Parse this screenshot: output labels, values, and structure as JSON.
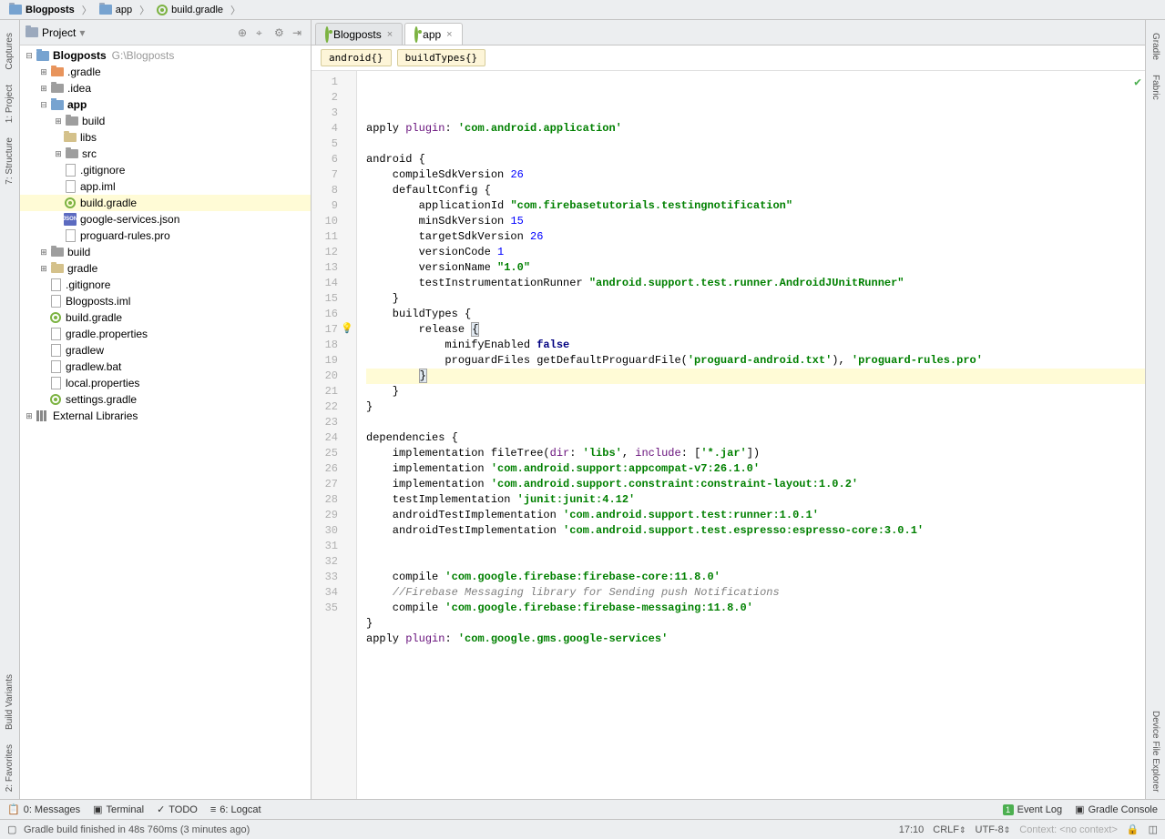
{
  "breadcrumbs": [
    "Blogposts",
    "app",
    "build.gradle"
  ],
  "project_panel": {
    "title": "Project",
    "root_name": "Blogposts",
    "root_path": "G:\\Blogposts",
    "nodes": {
      "gradle_dir": ".gradle",
      "idea_dir": ".idea",
      "app": "app",
      "app_build": "build",
      "app_libs": "libs",
      "app_src": "src",
      "gitignore": ".gitignore",
      "app_iml": "app.iml",
      "build_gradle": "build.gradle",
      "gservices": "google-services.json",
      "proguard": "proguard-rules.pro",
      "build": "build",
      "gradle": "gradle",
      "root_gitignore": ".gitignore",
      "root_iml": "Blogposts.iml",
      "root_build_gradle": "build.gradle",
      "gradle_props": "gradle.properties",
      "gradlew": "gradlew",
      "gradlew_bat": "gradlew.bat",
      "local_props": "local.properties",
      "settings_gradle": "settings.gradle",
      "ext_lib": "External Libraries"
    }
  },
  "tabs": [
    {
      "label": "Blogposts",
      "icon": "gradle",
      "active": false
    },
    {
      "label": "app",
      "icon": "gradle",
      "active": true
    }
  ],
  "crumbs": [
    "android{}",
    "buildTypes{}"
  ],
  "code": [
    {
      "n": 1,
      "seg": [
        [
          "",
          "apply "
        ],
        [
          "id",
          "plugin"
        ],
        [
          "",
          ": "
        ],
        [
          "str",
          "'com.android.application'"
        ]
      ]
    },
    {
      "n": 2,
      "seg": [
        [
          "",
          ""
        ]
      ]
    },
    {
      "n": 3,
      "seg": [
        [
          "",
          "android {"
        ]
      ]
    },
    {
      "n": 4,
      "seg": [
        [
          "",
          "    compileSdkVersion "
        ],
        [
          "num",
          "26"
        ]
      ]
    },
    {
      "n": 5,
      "seg": [
        [
          "",
          "    defaultConfig {"
        ]
      ]
    },
    {
      "n": 6,
      "seg": [
        [
          "",
          "        applicationId "
        ],
        [
          "str",
          "\"com.firebasetutorials.testingnotification\""
        ]
      ]
    },
    {
      "n": 7,
      "seg": [
        [
          "",
          "        minSdkVersion "
        ],
        [
          "num",
          "15"
        ]
      ]
    },
    {
      "n": 8,
      "seg": [
        [
          "",
          "        targetSdkVersion "
        ],
        [
          "num",
          "26"
        ]
      ]
    },
    {
      "n": 9,
      "seg": [
        [
          "",
          "        versionCode "
        ],
        [
          "num",
          "1"
        ]
      ]
    },
    {
      "n": 10,
      "seg": [
        [
          "",
          "        versionName "
        ],
        [
          "str",
          "\"1.0\""
        ]
      ]
    },
    {
      "n": 11,
      "seg": [
        [
          "",
          "        testInstrumentationRunner "
        ],
        [
          "str",
          "\"android.support.test.runner.AndroidJUnitRunner\""
        ]
      ]
    },
    {
      "n": 12,
      "seg": [
        [
          "",
          "    }"
        ]
      ]
    },
    {
      "n": 13,
      "seg": [
        [
          "",
          "    buildTypes {"
        ]
      ]
    },
    {
      "n": 14,
      "seg": [
        [
          "",
          "        release "
        ],
        [
          "brace",
          "{"
        ]
      ]
    },
    {
      "n": 15,
      "seg": [
        [
          "",
          "            minifyEnabled "
        ],
        [
          "lit",
          "false"
        ]
      ]
    },
    {
      "n": 16,
      "seg": [
        [
          "",
          "            proguardFiles getDefaultProguardFile("
        ],
        [
          "str",
          "'proguard-android.txt'"
        ],
        [
          "",
          ")"
        ],
        [
          "",
          ", "
        ],
        [
          "str",
          "'proguard-rules.pro'"
        ]
      ]
    },
    {
      "n": 17,
      "hl": true,
      "seg": [
        [
          "",
          "        "
        ],
        [
          "brace",
          "}"
        ]
      ]
    },
    {
      "n": 18,
      "seg": [
        [
          "",
          "    }"
        ]
      ]
    },
    {
      "n": 19,
      "seg": [
        [
          "",
          "}"
        ]
      ]
    },
    {
      "n": 20,
      "blank": true,
      "seg": [
        [
          "",
          ""
        ]
      ]
    },
    {
      "n": 21,
      "seg": [
        [
          "",
          "dependencies {"
        ]
      ]
    },
    {
      "n": 22,
      "seg": [
        [
          "",
          "    implementation fileTree("
        ],
        [
          "id",
          "dir"
        ],
        [
          "",
          ": "
        ],
        [
          "str",
          "'libs'"
        ],
        [
          "",
          ", "
        ],
        [
          "id",
          "include"
        ],
        [
          "",
          ": ["
        ],
        [
          "str",
          "'*.jar'"
        ],
        [
          "",
          "])"
        ]
      ]
    },
    {
      "n": 23,
      "seg": [
        [
          "",
          "    implementation "
        ],
        [
          "str",
          "'com.android.support:appcompat-v7:26.1.0'"
        ]
      ]
    },
    {
      "n": 24,
      "seg": [
        [
          "",
          "    implementation "
        ],
        [
          "str",
          "'com.android.support.constraint:constraint-layout:1.0.2'"
        ]
      ]
    },
    {
      "n": 25,
      "seg": [
        [
          "",
          "    testImplementation "
        ],
        [
          "str",
          "'junit:junit:4.12'"
        ]
      ]
    },
    {
      "n": 26,
      "seg": [
        [
          "",
          "    androidTestImplementation "
        ],
        [
          "str",
          "'com.android.support.test:runner:1.0.1'"
        ]
      ]
    },
    {
      "n": 27,
      "seg": [
        [
          "",
          "    androidTestImplementation "
        ],
        [
          "str",
          "'com.android.support.test.espresso:espresso-core:3.0.1'"
        ]
      ]
    },
    {
      "n": 28,
      "seg": [
        [
          "",
          ""
        ]
      ]
    },
    {
      "n": 29,
      "seg": [
        [
          "",
          ""
        ]
      ]
    },
    {
      "n": 30,
      "seg": [
        [
          "",
          "    compile "
        ],
        [
          "str",
          "'com.google.firebase:firebase-core:11.8.0'"
        ]
      ]
    },
    {
      "n": 31,
      "seg": [
        [
          "",
          "    "
        ],
        [
          "cmt",
          "//Firebase Messaging library for Sending push Notifications"
        ]
      ]
    },
    {
      "n": 32,
      "seg": [
        [
          "",
          "    compile "
        ],
        [
          "str",
          "'com.google.firebase:firebase-messaging:11.8.0'"
        ]
      ]
    },
    {
      "n": 33,
      "seg": [
        [
          "",
          "}"
        ]
      ]
    },
    {
      "n": 34,
      "seg": [
        [
          "",
          "apply "
        ],
        [
          "id",
          "plugin"
        ],
        [
          "",
          ": "
        ],
        [
          "str",
          "'com.google.gms.google-services'"
        ]
      ]
    },
    {
      "n": 35,
      "seg": [
        [
          "",
          ""
        ]
      ]
    }
  ],
  "left_rail": {
    "captures": "Captures",
    "project": "1: Project",
    "structure": "7: Structure",
    "build_variants": "Build Variants",
    "favorites": "2: Favorites"
  },
  "right_rail": {
    "gradle": "Gradle",
    "fabric": "Fabric",
    "explorer": "Device File Explorer"
  },
  "tool_tabs": {
    "messages": "0: Messages",
    "terminal": "Terminal",
    "todo": "TODO",
    "logcat": "6: Logcat",
    "event_log": "Event Log",
    "gradle_console": "Gradle Console"
  },
  "status": {
    "msg": "Gradle build finished in 48s 760ms (3 minutes ago)",
    "pos": "17:10",
    "eol": "CRLF",
    "enc": "UTF-8",
    "ctx": "Context: <no context>"
  }
}
